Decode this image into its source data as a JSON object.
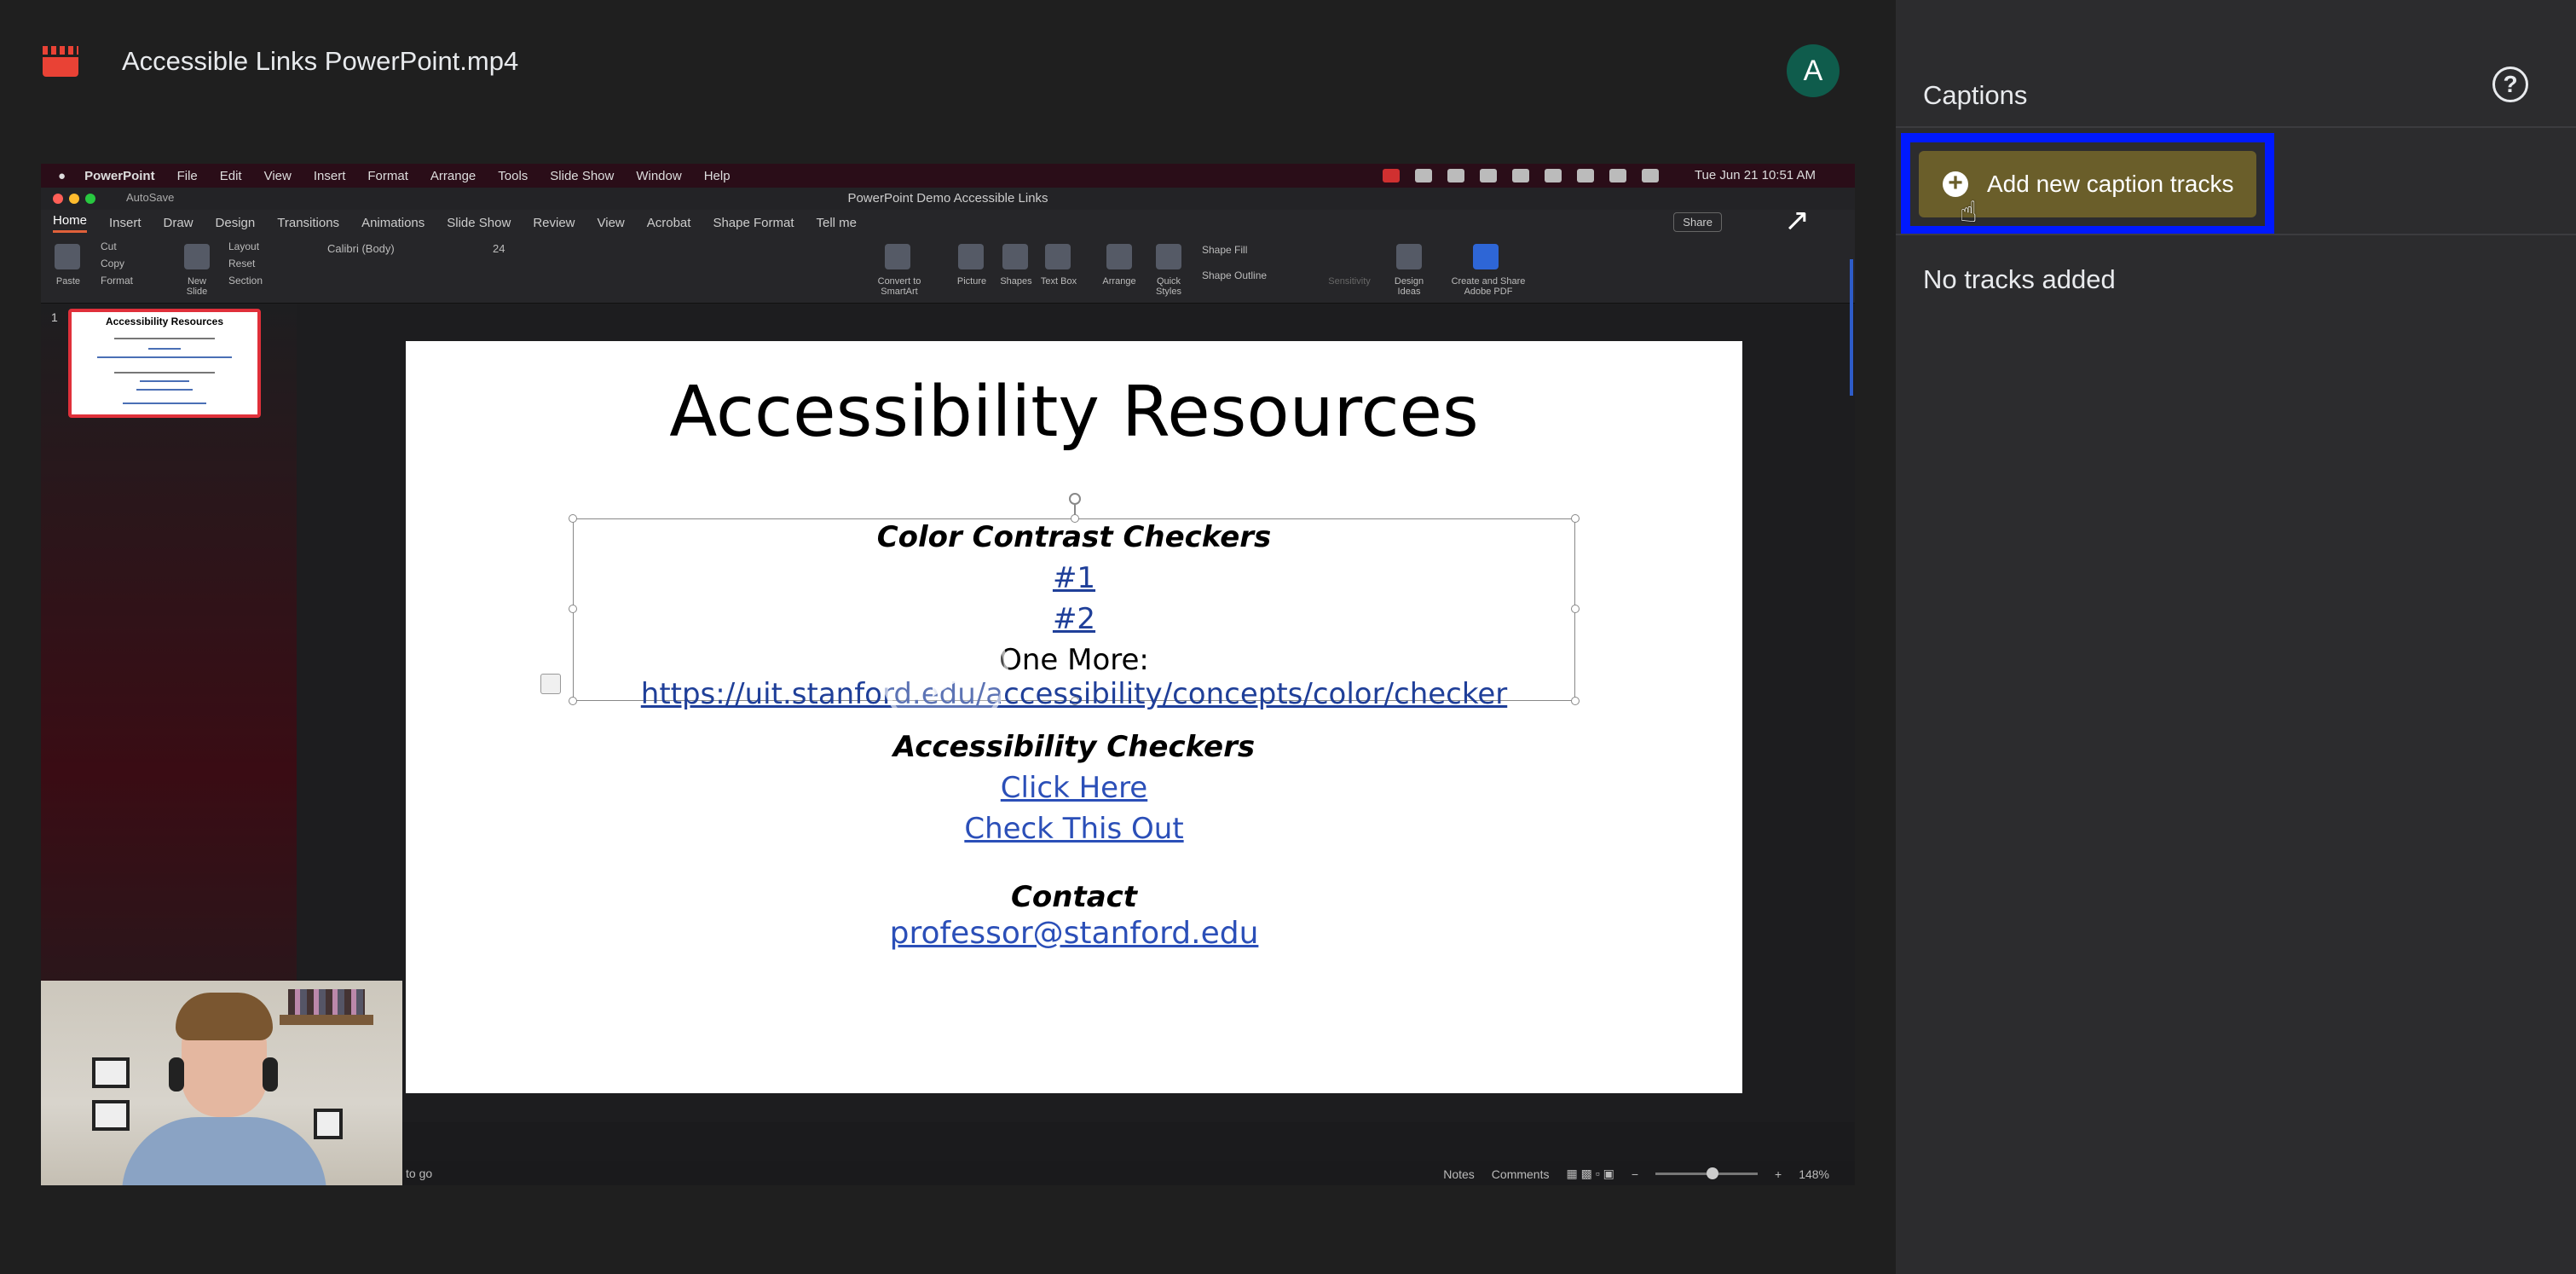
{
  "header": {
    "file_title": "Accessible Links PowerPoint.mp4",
    "avatar_letter": "A",
    "app_icon": "video-clapper-icon"
  },
  "video": {
    "menubar": {
      "app": "PowerPoint",
      "items": [
        "File",
        "Edit",
        "View",
        "Insert",
        "Format",
        "Arrange",
        "Tools",
        "Slide Show",
        "Window",
        "Help"
      ],
      "clock": "Tue Jun 21  10:51 AM"
    },
    "window_title": "PowerPoint Demo Accessible Links",
    "autosave": "AutoSave",
    "ribbon_tabs": [
      "Home",
      "Insert",
      "Draw",
      "Design",
      "Transitions",
      "Animations",
      "Slide Show",
      "Review",
      "View",
      "Acrobat",
      "Shape Format",
      "Tell me"
    ],
    "share": "Share",
    "ribbon": {
      "paste": "Paste",
      "cut": "Cut",
      "copy": "Copy",
      "format": "Format",
      "new_slide": "New Slide",
      "layout": "Layout",
      "reset": "Reset",
      "section": "Section",
      "font": "Calibri (Body)",
      "size": "24",
      "convert": "Convert to SmartArt",
      "picture": "Picture",
      "shapes": "Shapes",
      "textbox": "Text Box",
      "arrange": "Arrange",
      "quick_styles": "Quick Styles",
      "shape_fill": "Shape Fill",
      "shape_outline": "Shape Outline",
      "sensitivity": "Sensitivity",
      "design_ideas": "Design Ideas",
      "create_share": "Create and Share Adobe PDF"
    },
    "thumb_number": "1",
    "thumb_title": "Accessibility Resources",
    "slide": {
      "title": "Accessibility Resources",
      "color_heading": "Color Contrast Checkers",
      "link1": "#1",
      "link2": "#2",
      "one_more_label": "One More: ",
      "one_more_link": "https://uit.stanford.edu/accessibility/concepts/color/checker",
      "checkers_heading": "Accessibility Checkers",
      "click_here": "Click Here",
      "check_this": "Check This Out",
      "contact_heading": "Contact",
      "email": "professor@stanford.edu"
    },
    "statusbar": {
      "left": "to go",
      "notes": "Notes",
      "comments": "Comments",
      "zoom": "148%"
    }
  },
  "panel": {
    "title": "Captions",
    "add_button": "Add new caption tracks",
    "empty_text": "No tracks added",
    "highlight_color": "#0019ff",
    "button_color": "#6a5e2a"
  }
}
